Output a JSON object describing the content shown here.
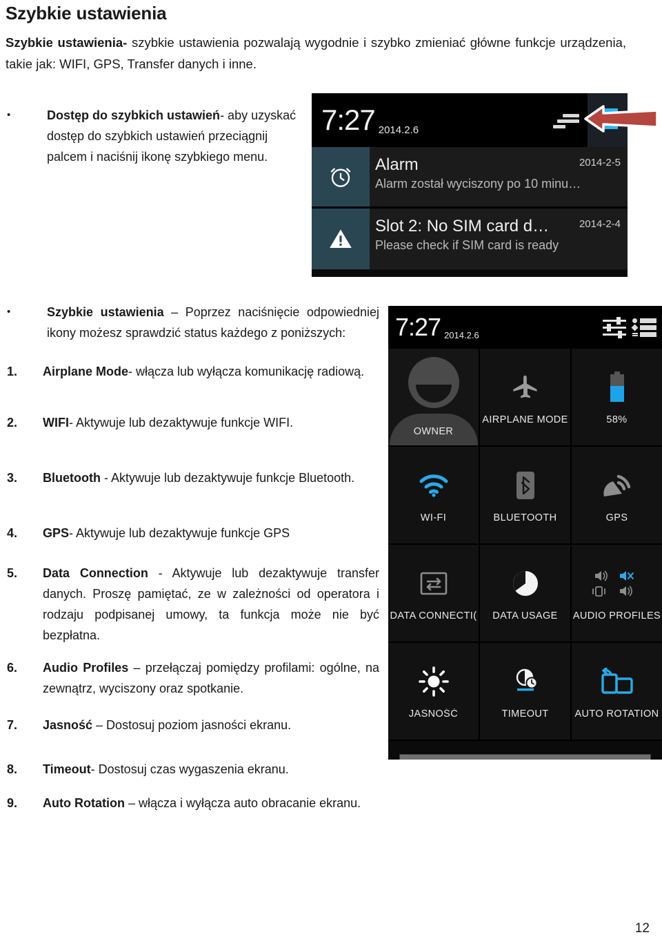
{
  "document": {
    "title": "Szybkie ustawienia",
    "intro_lead": "Szybkie ustawienia-",
    "intro_rest": " szybkie ustawienia pozwalają wygodnie i szybko zmieniać główne funkcje urządzenia, takie jak: WIFI, GPS, Transfer danych i inne.",
    "page_number": "12"
  },
  "bullets": [
    {
      "marker": "•",
      "bold": "Dostęp do szybkich ustawień",
      "rest": "- aby uzyskać dostęp do szybkich ustawień przeciągnij palcem i naciśnij ikonę szybkiego menu."
    },
    {
      "marker": "•",
      "bold": "Szybkie ustawienia",
      "rest": " – Poprzez naciśnięcie odpowiedniej ikony możesz sprawdzić status każdego z poniższych:"
    }
  ],
  "numbered_items": [
    {
      "num": "1.",
      "bold": "Airplane Mode",
      "rest": "- włącza lub wyłącza komunikację radiową."
    },
    {
      "num": "2.",
      "bold": "WIFI",
      "rest": "- Aktywuje lub dezaktywuje funkcje WIFI."
    },
    {
      "num": "3.",
      "bold": "Bluetooth",
      "rest": " - Aktywuje lub dezaktywuje funkcje Bluetooth."
    },
    {
      "num": "4.",
      "bold": "GPS",
      "rest": "- Aktywuje lub dezaktywuje funkcje GPS"
    },
    {
      "num": "5.",
      "bold": "Data Connection",
      "rest": " - Aktywuje lub dezaktywuje transfer danych. Proszę pamiętać, ze w zależności od operatora i rodzaju podpisanej umowy, ta funkcja może nie być bezpłatna."
    },
    {
      "num": "6.",
      "bold": "Audio Profiles",
      "rest": " – przełączaj pomiędzy profilami: ogólne, na zewnątrz, wyciszony oraz spotkanie."
    },
    {
      "num": "7.",
      "bold": "Jasność",
      "rest": " – Dostosuj poziom jasności ekranu."
    },
    {
      "num": "8.",
      "bold": "Timeout",
      "rest": "- Dostosuj czas wygaszenia ekranu."
    },
    {
      "num": "9.",
      "bold": "Auto Rotation",
      "rest": " – włącza i wyłącza auto obracanie ekranu."
    }
  ],
  "screenshot_notifications": {
    "statusbar": {
      "clock": "7:27",
      "date": "2014.2.6",
      "lines_icon": "notification-lines-icon",
      "quick_settings_icon": "quick-settings-icon"
    },
    "notifications": [
      {
        "icon": "alarm-clock-icon",
        "title": "Alarm",
        "subtitle": "Alarm został wyciszony po 10 minu…",
        "date": "2014-2-5"
      },
      {
        "icon": "warning-triangle-icon",
        "title": "Slot 2: No SIM card d…",
        "subtitle": "Please check if SIM card is ready",
        "date": "2014-2-4"
      }
    ],
    "annotation": {
      "arrow": "red-left-arrow",
      "arrow_color": "#b5453f"
    }
  },
  "screenshot_quick_settings": {
    "statusbar": {
      "clock": "7:27",
      "date": "2014.2.6",
      "sliders_icon": "settings-sliders-icon",
      "list_icon": "notification-list-icon"
    },
    "tiles": [
      {
        "icon": "user-avatar-icon",
        "label": "OWNER",
        "state": "off"
      },
      {
        "icon": "airplane-icon",
        "label": "AIRPLANE MODE",
        "state": "off"
      },
      {
        "icon": "battery-icon",
        "label": "58%",
        "state": "on"
      },
      {
        "icon": "wifi-icon",
        "label": "WI-FI",
        "state": "on"
      },
      {
        "icon": "bluetooth-icon",
        "label": "BLUETOOTH",
        "state": "off"
      },
      {
        "icon": "gps-satellite-icon",
        "label": "GPS",
        "state": "off"
      },
      {
        "icon": "data-connection-icon",
        "label": "DATA CONNECTI(",
        "state": "off"
      },
      {
        "icon": "data-usage-pie-icon",
        "label": "DATA USAGE",
        "state": "on"
      },
      {
        "icon": "audio-profiles-icon",
        "label": "AUDIO PROFILES",
        "state": "on"
      },
      {
        "icon": "brightness-sun-icon",
        "label": "JASNOŚĆ",
        "state": "on"
      },
      {
        "icon": "screen-timeout-icon",
        "label": "TIMEOUT",
        "state": "on"
      },
      {
        "icon": "auto-rotation-icon",
        "label": "AUTO ROTATION",
        "state": "on"
      }
    ],
    "drag_handle": "panel-drag-handle",
    "battery_percent": "58%",
    "accent_color": "#32b0e8"
  }
}
